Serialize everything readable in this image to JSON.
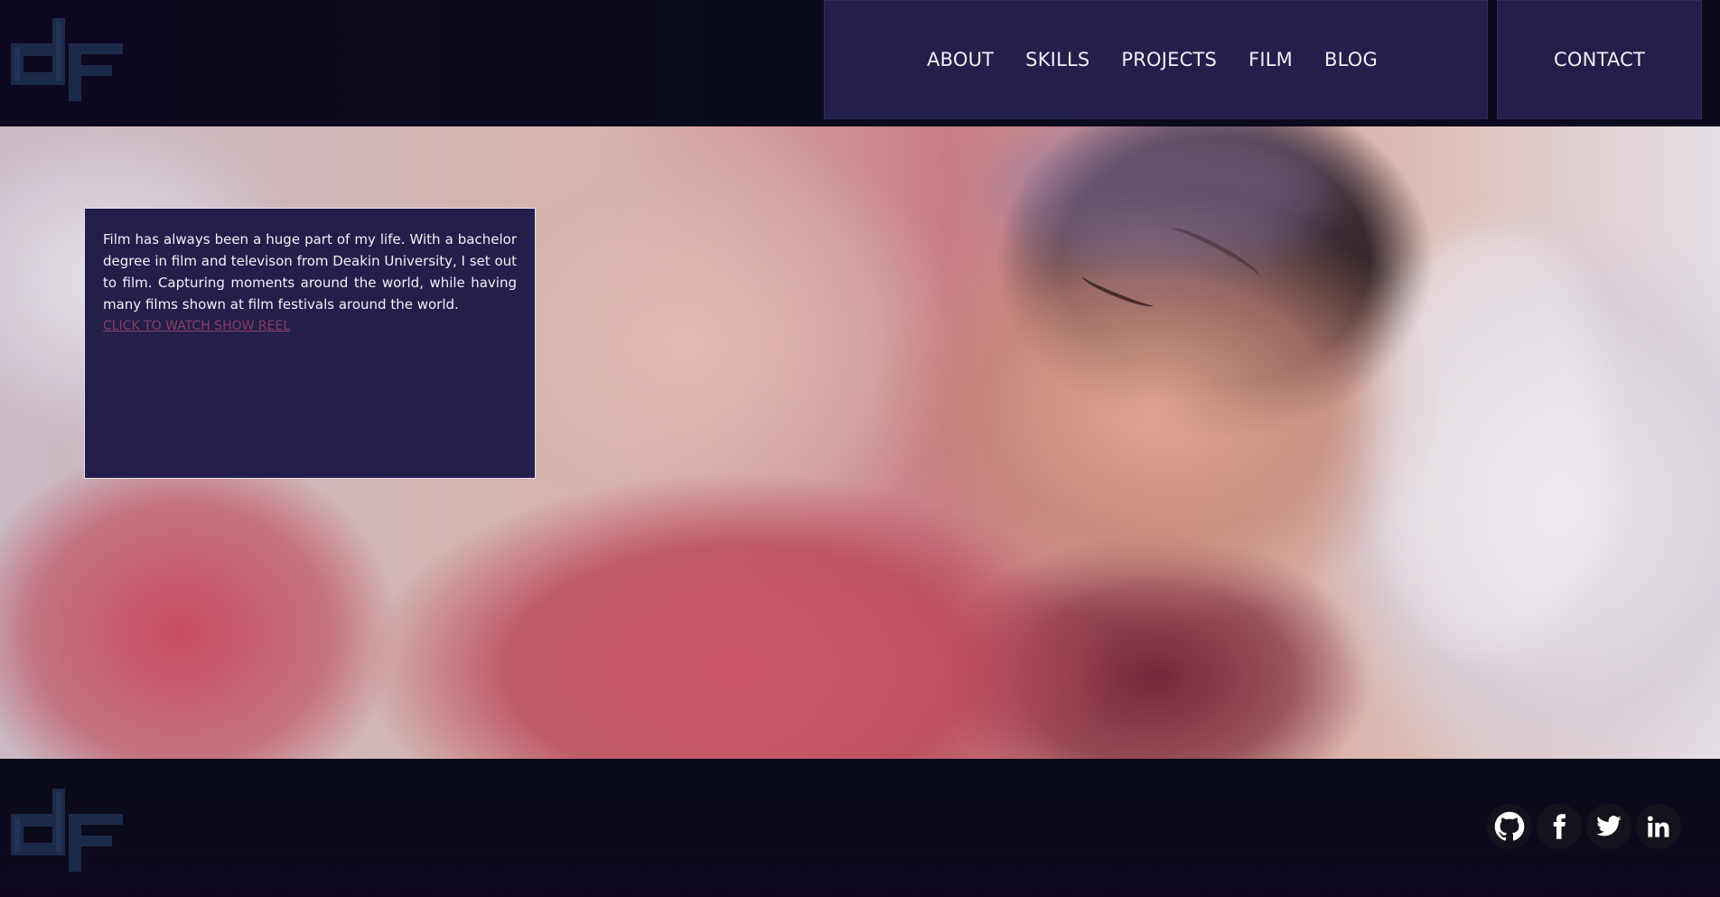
{
  "header": {
    "logo_icon": "df-logo-icon",
    "nav": [
      {
        "label": "ABOUT"
      },
      {
        "label": "SKILLS"
      },
      {
        "label": "PROJECTS"
      },
      {
        "label": "FILM"
      },
      {
        "label": "BLOG"
      }
    ],
    "contact_label": "CONTACT"
  },
  "hero": {
    "image": "blurred-sleeping-person-photo",
    "card": {
      "text": "Film has always been a huge part of my life. With a bachelor degree in film and televison from Deakin University, I set out to film. Capturing moments around the world, while having many films shown at film festivals around the world.",
      "link_label": "CLICK TO WATCH SHOW REEL"
    }
  },
  "footer": {
    "logo_icon": "df-logo-icon",
    "social": [
      {
        "icon": "github-icon"
      },
      {
        "icon": "facebook-icon"
      },
      {
        "icon": "twitter-icon"
      },
      {
        "icon": "linkedin-icon"
      }
    ]
  },
  "colors": {
    "background": "#0b0a17",
    "panel": "#231e4a",
    "card_border": "#e6e0ef",
    "link": "#8a3e68",
    "logo": "#1c2a4a"
  }
}
